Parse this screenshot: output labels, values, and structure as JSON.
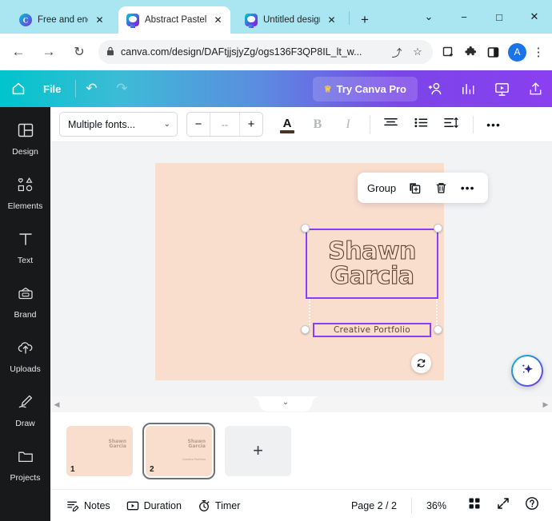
{
  "browser": {
    "tabs": [
      {
        "title": "Free and engag",
        "favicon": "canva-circle-icon",
        "active": false
      },
      {
        "title": "Abstract Pastel",
        "favicon": "canva-logo-icon",
        "active": true
      },
      {
        "title": "Untitled design",
        "favicon": "canva-logo-icon",
        "active": false
      }
    ],
    "new_tab_label": "+",
    "window_controls": {
      "minimize": "−",
      "maximize": "□",
      "close": "✕",
      "tab_search": "⌄"
    },
    "toolbar": {
      "back": "←",
      "forward": "→",
      "reload": "↻",
      "lock": "🔒",
      "url": "canva.com/design/DAFtjjsjyZg/ogs136F3QP8IL_lt_w...",
      "share": "⤴",
      "bookmark": "☆",
      "reading_list": "▤",
      "extensions": "✦",
      "sidepanel": "◧",
      "avatar_initial": "A",
      "menu": "⋮"
    }
  },
  "canva_topbar": {
    "home_icon": "home-icon",
    "file_label": "File",
    "undo_icon": "↶",
    "redo_icon": "↷",
    "try_pro_label": "Try Canva Pro",
    "crown_icon": "♕",
    "icons": [
      "add-collaborator-icon",
      "analytics-icon",
      "present-icon",
      "share-export-icon"
    ]
  },
  "rail": {
    "items": [
      {
        "label": "Design",
        "icon": "design-layout-icon"
      },
      {
        "label": "Elements",
        "icon": "shapes-icon"
      },
      {
        "label": "Text",
        "icon": "text-T-icon"
      },
      {
        "label": "Brand",
        "icon": "brand-kit-icon"
      },
      {
        "label": "Uploads",
        "icon": "upload-cloud-icon"
      },
      {
        "label": "Draw",
        "icon": "pen-icon"
      },
      {
        "label": "Projects",
        "icon": "folder-icon"
      }
    ]
  },
  "editor_toolbar": {
    "font_name": "Multiple fonts...",
    "font_chevron": "⌄",
    "size_minus": "−",
    "size_value": "--",
    "size_plus": "+",
    "text_color_letter": "A",
    "text_color_hex": "#4a3324",
    "bold_label": "B",
    "italic_label": "I",
    "align_icon": "align-center-icon",
    "list_icon": "bulleted-list-icon",
    "spacing_icon": "line-spacing-icon",
    "more_label": "•••"
  },
  "canvas": {
    "page_background": "#f9ddcd",
    "selection_color": "#8b3dff",
    "float_toolbar": {
      "group_label": "Group",
      "duplicate_icon": "duplicate-icon",
      "delete_icon": "trash-icon",
      "more_label": "•••"
    },
    "title_text_line1": "Shawn",
    "title_text_line2": "Garcia",
    "subtitle_text": "Creative Portfolio",
    "rotate_icon": "rotate-icon",
    "magic_icon": "sparkle-magic-icon"
  },
  "scroll_strip": {
    "left_arrow": "◀",
    "right_arrow": "▶",
    "collapse_icon": "⌄"
  },
  "pages": {
    "thumbs": [
      {
        "number": "1",
        "title_line1": "Shawn",
        "title_line2": "Garcia",
        "subtitle": ""
      },
      {
        "number": "2",
        "title_line1": "Shawn",
        "title_line2": "Garcia",
        "subtitle": "Creative Portfolio"
      }
    ],
    "add_label": "+"
  },
  "bottom_bar": {
    "notes_label": "Notes",
    "notes_icon": "notes-icon",
    "duration_label": "Duration",
    "duration_icon": "duration-icon",
    "timer_label": "Timer",
    "timer_icon": "timer-icon",
    "page_indicator": "Page 2 / 2",
    "zoom_level": "36%",
    "grid_icon": "grid-view-icon",
    "fullscreen_icon": "fullscreen-icon",
    "help_icon": "help-icon"
  }
}
